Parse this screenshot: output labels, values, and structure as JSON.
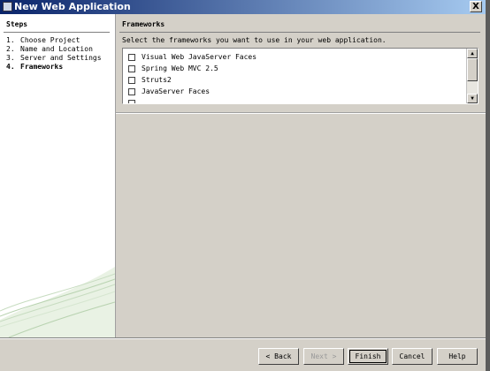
{
  "window": {
    "title": "New Web Application",
    "close_label": "X"
  },
  "steps": {
    "heading": "Steps",
    "items": [
      {
        "num": "1.",
        "label": "Choose Project"
      },
      {
        "num": "2.",
        "label": "Name and Location"
      },
      {
        "num": "3.",
        "label": "Server and Settings"
      },
      {
        "num": "4.",
        "label": "Frameworks"
      }
    ]
  },
  "main": {
    "heading": "Frameworks",
    "instruction": "Select the frameworks you want to use in your web application.",
    "frameworks": [
      {
        "label": "Visual Web JavaServer Faces",
        "checked": false
      },
      {
        "label": "Spring Web MVC 2.5",
        "checked": false
      },
      {
        "label": "Struts2",
        "checked": false
      },
      {
        "label": "JavaServer Faces",
        "checked": false
      }
    ]
  },
  "buttons": {
    "back": "< Back",
    "next": "Next >",
    "finish": "Finish",
    "cancel": "Cancel",
    "help": "Help"
  }
}
